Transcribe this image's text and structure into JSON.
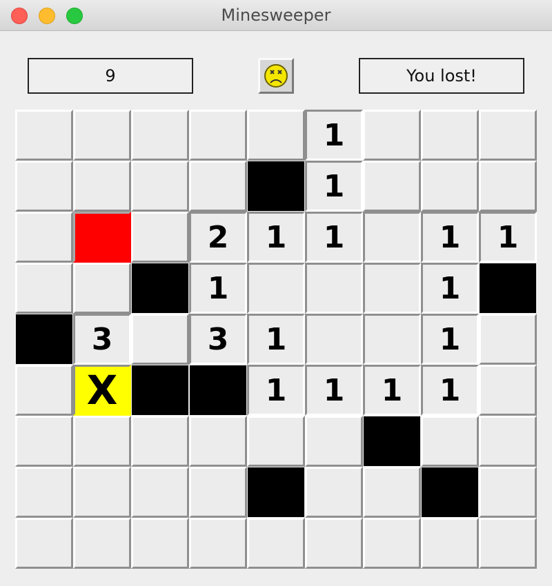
{
  "window": {
    "title": "Minesweeper",
    "buttons": [
      "close",
      "minimize",
      "zoom"
    ]
  },
  "toolbar": {
    "mine_counter": "9",
    "status_text": "You lost!",
    "face_icon": "sad-face-icon"
  },
  "colors": {
    "face": "#f5e600",
    "exploded": "#ff0000",
    "wrong_flag": "#ffff00",
    "mine": "#000000"
  },
  "board": {
    "rows": 9,
    "cols": 9,
    "cells": [
      [
        "H",
        "H",
        "H",
        "H",
        "H",
        "1",
        "H",
        "H",
        "H"
      ],
      [
        "H",
        "H",
        "H",
        "H",
        "M",
        "1",
        "H",
        "H",
        "H"
      ],
      [
        "H",
        "E",
        "H",
        "2",
        "1",
        "1",
        "R",
        "1",
        "1"
      ],
      [
        "H",
        "H",
        "M",
        "1",
        "R",
        "R",
        "R",
        "1",
        "M"
      ],
      [
        "M",
        "3",
        "H",
        "3",
        "1",
        "R",
        "R",
        "1",
        "H"
      ],
      [
        "H",
        "X",
        "M",
        "M",
        "1",
        "1",
        "1",
        "1",
        "H"
      ],
      [
        "H",
        "H",
        "H",
        "H",
        "H",
        "H",
        "M",
        "H",
        "H"
      ],
      [
        "H",
        "H",
        "H",
        "H",
        "M",
        "H",
        "H",
        "M",
        "H"
      ],
      [
        "H",
        "H",
        "H",
        "H",
        "H",
        "H",
        "H",
        "H",
        "H"
      ]
    ]
  }
}
